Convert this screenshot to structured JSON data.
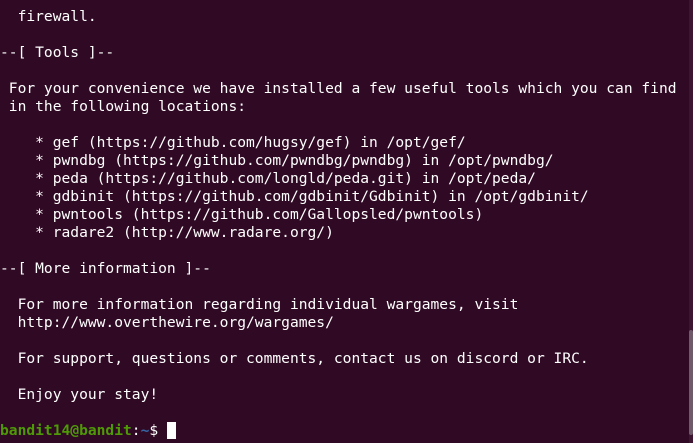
{
  "terminal": {
    "lines": [
      "  firewall.",
      "",
      "--[ Tools ]--",
      "",
      " For your convenience we have installed a few useful tools which you can find",
      " in the following locations:",
      "",
      "    * gef (https://github.com/hugsy/gef) in /opt/gef/",
      "    * pwndbg (https://github.com/pwndbg/pwndbg) in /opt/pwndbg/",
      "    * peda (https://github.com/longld/peda.git) in /opt/peda/",
      "    * gdbinit (https://github.com/gdbinit/Gdbinit) in /opt/gdbinit/",
      "    * pwntools (https://github.com/Gallopsled/pwntools)",
      "    * radare2 (http://www.radare.org/)",
      "",
      "--[ More information ]--",
      "",
      "  For more information regarding individual wargames, visit",
      "  http://www.overthewire.org/wargames/",
      "",
      "  For support, questions or comments, contact us on discord or IRC.",
      "",
      "  Enjoy your stay!",
      ""
    ],
    "prompt": {
      "user_host": "bandit14@bandit",
      "separator": ":",
      "path": "~",
      "symbol": "$"
    }
  },
  "colors": {
    "background": "#300a24",
    "text": "#ffffff",
    "prompt_user": "#4e9a06",
    "prompt_path": "#3465a4"
  }
}
